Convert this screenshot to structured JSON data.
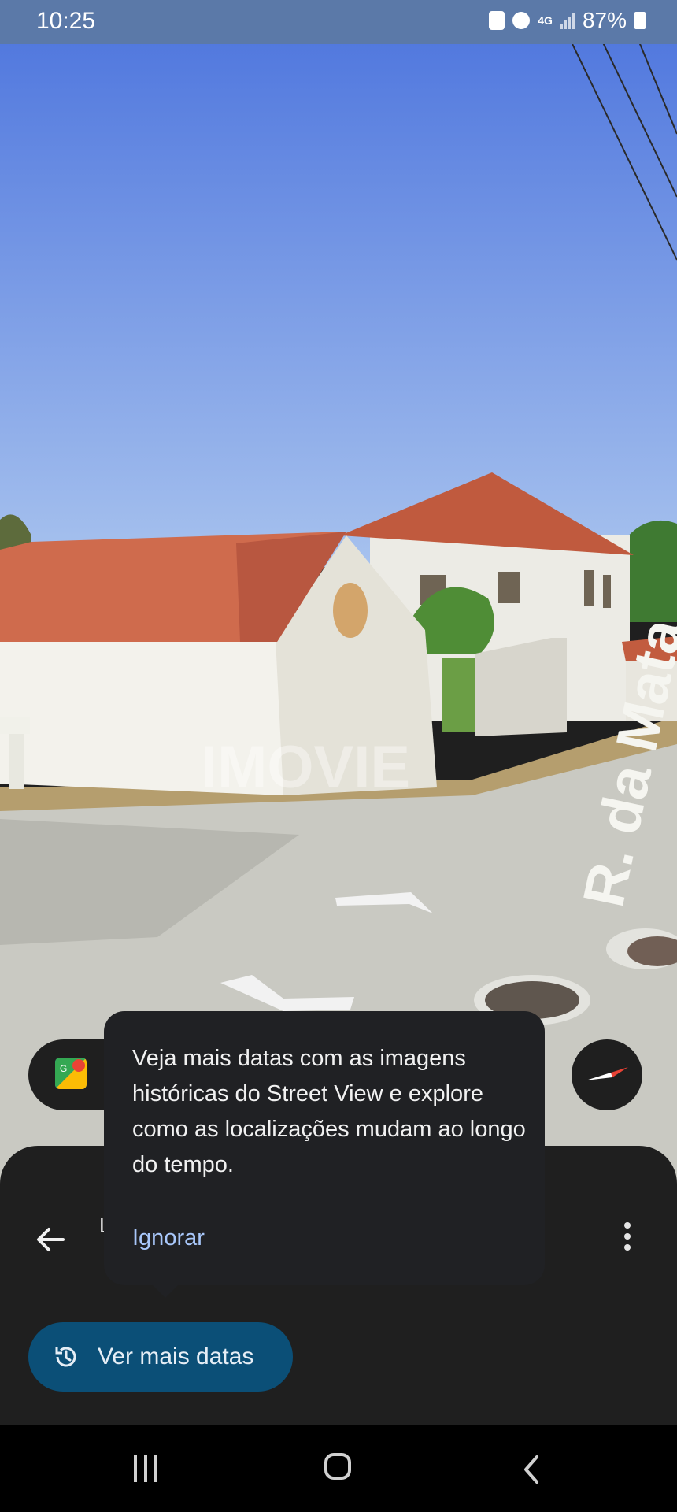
{
  "status_bar": {
    "time": "10:25",
    "network_type": "4G",
    "battery": "87%"
  },
  "street_view": {
    "street_sign_text": "R. da Mata",
    "watermark": "IMOVIE"
  },
  "tooltip": {
    "message": "Veja mais datas com as imagens históricas do Street View e explore como as localizações mudam ao longo do tempo.",
    "dismiss_label": "Ignorar"
  },
  "bottom_sheet": {
    "partial_title_char": "L",
    "see_more_dates_label": "Ver mais datas"
  },
  "colors": {
    "accent_button": "#0b4f77",
    "tooltip_link": "#a8c7fa",
    "sheet_background": "#1f1f1f"
  }
}
